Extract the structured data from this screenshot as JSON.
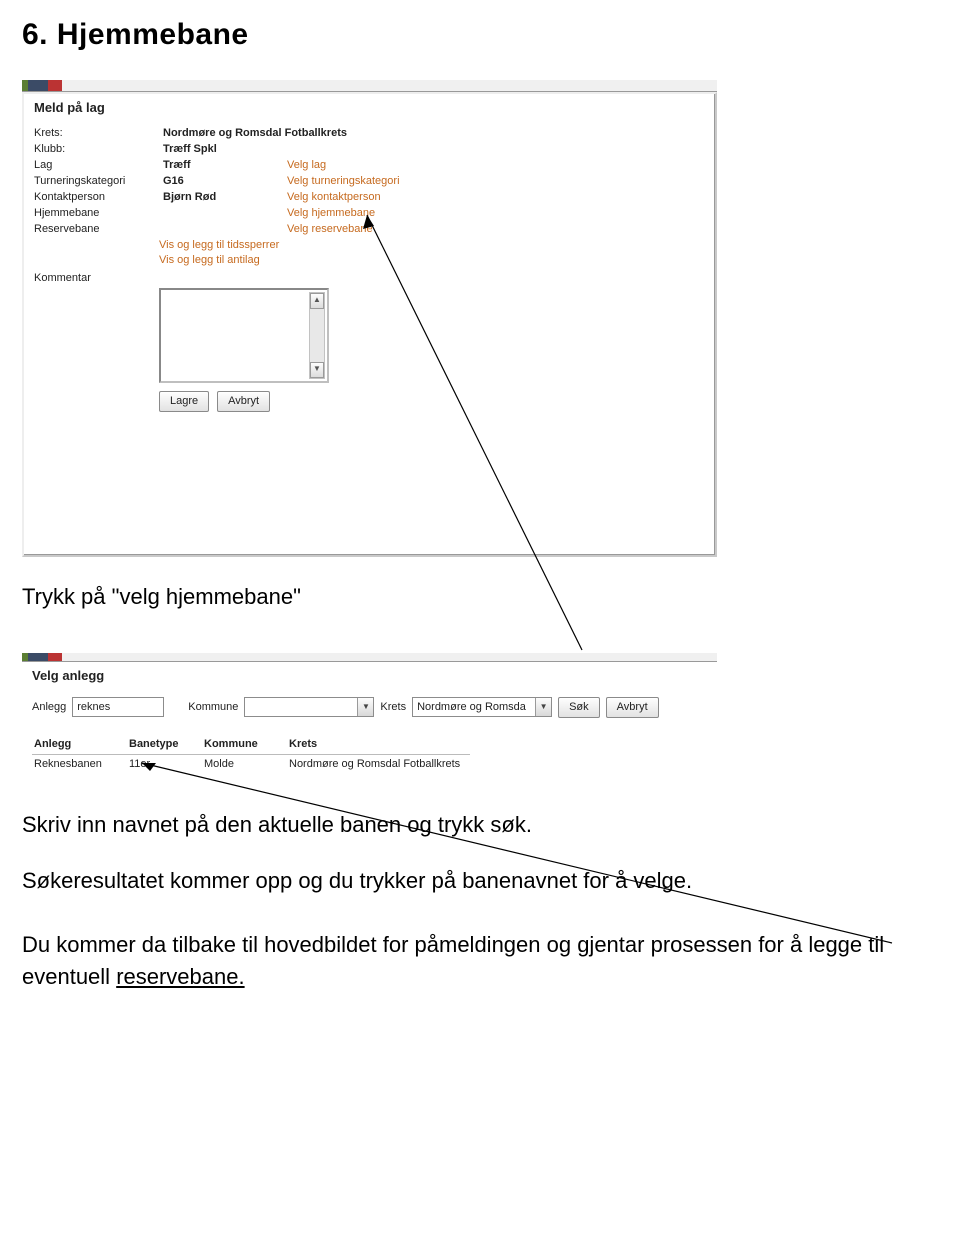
{
  "doc": {
    "heading": "6. Hjemmebane",
    "p1": "Trykk på \"velg hjemmebane\"",
    "p2": "Skriv inn navnet på den aktuelle banen og trykk søk.",
    "p3": "Søkeresultatet kommer opp og du trykker på banenavnet for å velge.",
    "p4_a": "Du kommer da tilbake til hovedbildet for påmeldingen og gjentar prosessen for å legge til eventuell ",
    "p4_b": "reservebane."
  },
  "shot1": {
    "title": "Meld på lag",
    "rows": {
      "krets_label": "Krets:",
      "krets_value": "Nordmøre og Romsdal Fotballkrets",
      "klubb_label": "Klubb:",
      "klubb_value": "Træff Spkl",
      "lag_label": "Lag",
      "lag_value": "Træff",
      "lag_link": "Velg lag",
      "kat_label": "Turneringskategori",
      "kat_value": "G16",
      "kat_link": "Velg turneringskategori",
      "kontakt_label": "Kontaktperson",
      "kontakt_value": "Bjørn Rød",
      "kontakt_link": "Velg kontaktperson",
      "hjemme_label": "Hjemmebane",
      "hjemme_link": "Velg hjemmebane",
      "reserve_label": "Reservebane",
      "reserve_link": "Velg reservebane"
    },
    "extra1": "Vis og legg til tidssperrer",
    "extra2": "Vis og legg til antilag",
    "kommentar_label": "Kommentar",
    "lagre": "Lagre",
    "avbryt": "Avbryt"
  },
  "shot2": {
    "title": "Velg anlegg",
    "labels": {
      "anlegg": "Anlegg",
      "kommune": "Kommune",
      "krets": "Krets"
    },
    "values": {
      "anlegg": "reknes",
      "kommune": "",
      "krets": "Nordmøre og Romsda"
    },
    "sok": "Søk",
    "avbryt": "Avbryt",
    "cols": {
      "anlegg": "Anlegg",
      "banetype": "Banetype",
      "kommune": "Kommune",
      "krets": "Krets"
    },
    "row": {
      "anlegg": "Reknesbanen",
      "banetype": "11er",
      "kommune": "Molde",
      "krets": "Nordmøre og Romsdal Fotballkrets"
    }
  }
}
